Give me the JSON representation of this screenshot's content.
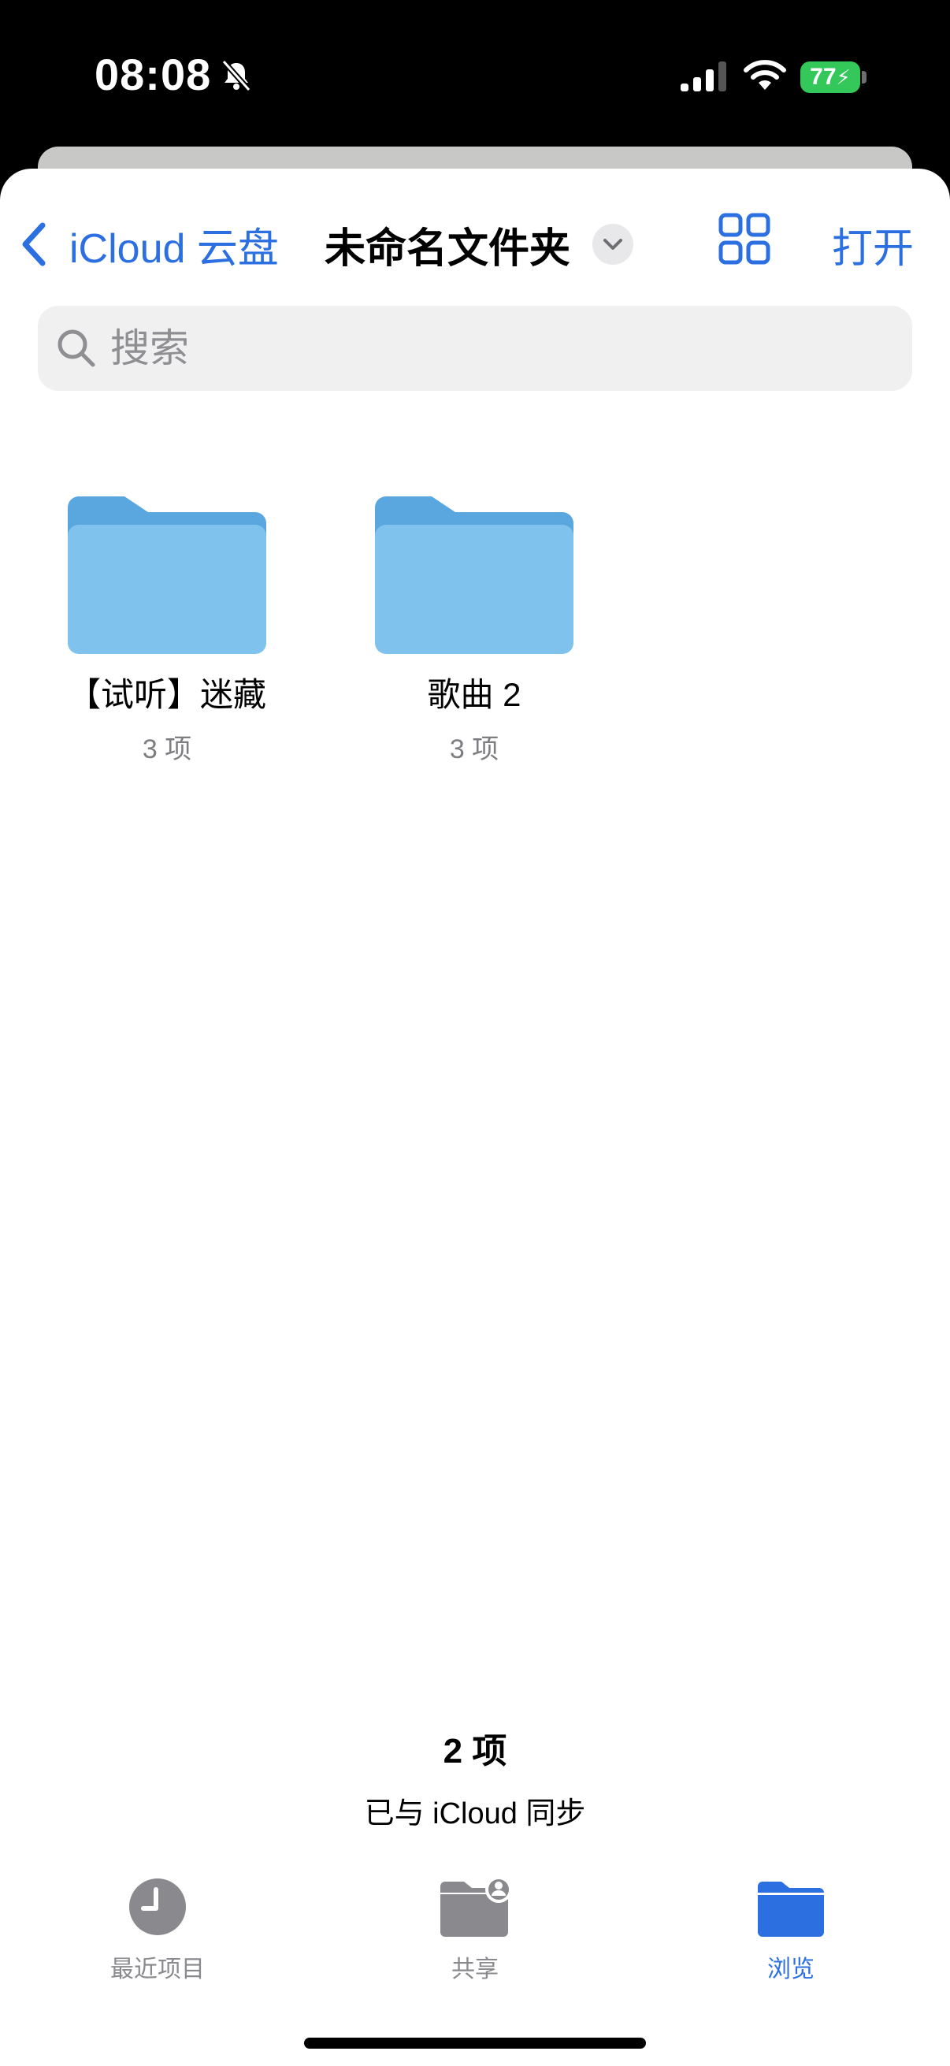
{
  "status_bar": {
    "time": "08:08",
    "battery": "77"
  },
  "nav": {
    "back_label": "iCloud 云盘",
    "title": "未命名文件夹",
    "open_label": "打开"
  },
  "search": {
    "placeholder": "搜索"
  },
  "folders": [
    {
      "name": "【试听】迷藏",
      "count": "3 项"
    },
    {
      "name": "歌曲 2",
      "count": "3 项"
    }
  ],
  "footer": {
    "item_count": "2 项",
    "sync_status": "已与 iCloud 同步"
  },
  "tabs": [
    {
      "label": "最近项目",
      "icon": "clock-icon",
      "active": false
    },
    {
      "label": "共享",
      "icon": "shared-folder-icon",
      "active": false
    },
    {
      "label": "浏览",
      "icon": "folder-icon",
      "active": true
    }
  ],
  "colors": {
    "accent": "#2c6fe0",
    "folder_light": "#82c6f0",
    "folder_dark": "#5aa6df",
    "battery": "#34c759"
  }
}
